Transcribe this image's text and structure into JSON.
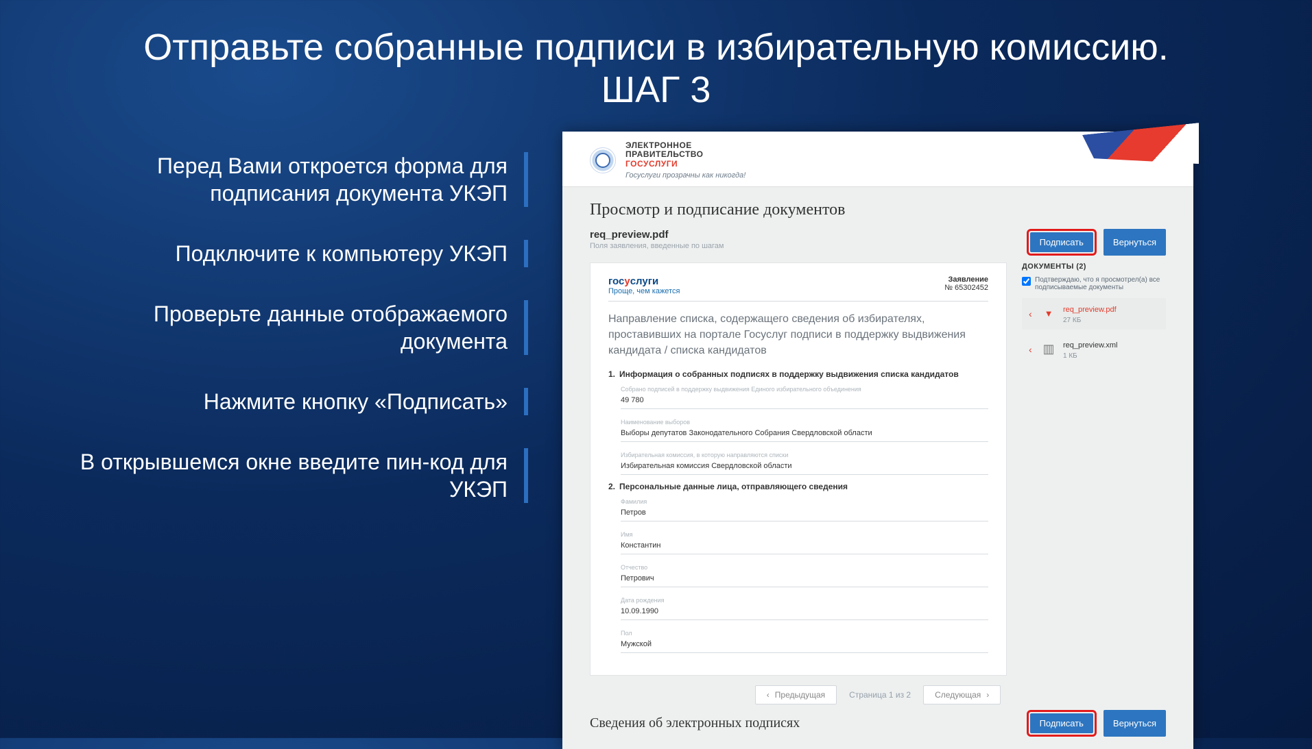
{
  "slide": {
    "title_line1": "Отправьте собранные подписи в избирательную комиссию.",
    "title_line2": "ШАГ 3",
    "steps": [
      "Перед Вами откроется форма для подписания документа УКЭП",
      "Подключите к компьютеру УКЭП",
      "Проверьте данные отображаемого документа",
      "Нажмите кнопку «Подписать»",
      "В открывшемся окне введите пин-код для УКЭП"
    ]
  },
  "ss": {
    "header": {
      "line1": "ЭЛЕКТРОННОЕ",
      "line2": "ПРАВИТЕЛЬСТВО",
      "line3": "ГОСУСЛУГИ",
      "tagline": "Госуслуги прозрачны как никогда!"
    },
    "page_title": "Просмотр и подписание документов",
    "file": {
      "name": "req_preview.pdf",
      "hint": "Поля заявления, введенные по шагам"
    },
    "buttons": {
      "sign": "Подписать",
      "back": "Вернуться"
    },
    "doc": {
      "brand1": "госуслуги",
      "brand2": "Проще, чем кажется",
      "app_label": "Заявление",
      "app_no": "№ 65302452",
      "big": "Направление списка, содержащего сведения об избирателях, проставивших на портале Госуслуг подписи в поддержку выдвижения кандидата / списка кандидатов",
      "sec1_title": "Информация о собранных подписях в поддержку выдвижения списка кандидатов",
      "f1_label": "Собрано подписей в поддержку выдвижения Единого избирательного объединения",
      "f1_value": "49 780",
      "f2_label": "Наименование выборов",
      "f2_value": "Выборы депутатов Законодательного Собрания Свердловской области",
      "f3_label": "Избирательная комиссия, в которую направляются списки",
      "f3_value": "Избирательная комиссия Свердловской области",
      "sec2_title": "Персональные данные лица, отправляющего сведения",
      "surname_label": "Фамилия",
      "surname": "Петров",
      "name_label": "Имя",
      "name": "Константин",
      "patr_label": "Отчество",
      "patr": "Петрович",
      "dob_label": "Дата рождения",
      "dob": "10.09.1990",
      "sex_label": "Пол",
      "sex": "Мужской"
    },
    "side": {
      "title": "ДОКУМЕНТЫ (2)",
      "confirm": "Подтверждаю, что я просмотрел(а) все подписываемые документы",
      "files": [
        {
          "name": "req_preview.pdf",
          "size": "27 КБ",
          "type": "pdf"
        },
        {
          "name": "req_preview.xml",
          "size": "1 КБ",
          "type": "xml"
        }
      ]
    },
    "pager": {
      "prev": "Предыдущая",
      "ind": "Страница 1 из 2",
      "next": "Следующая"
    },
    "footer_title": "Сведения об электронных подписях"
  }
}
